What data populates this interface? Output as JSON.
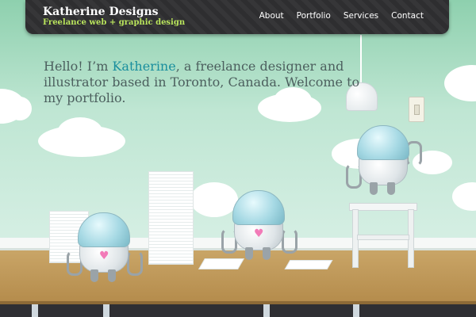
{
  "header": {
    "brand_title": "Katherine Designs",
    "brand_tagline": "Freelance web + graphic design",
    "nav": [
      {
        "label": "About"
      },
      {
        "label": "Portfolio"
      },
      {
        "label": "Services"
      },
      {
        "label": "Contact"
      }
    ]
  },
  "hero": {
    "intro_before": "Hello! I’m ",
    "name": "Katherine",
    "intro_after": ", a freelance designer and illustrator based in Toronto, Canada. Welcome to my portfolio."
  },
  "colors": {
    "accent": "#1a8f9e",
    "tagline": "#b9e45c",
    "nav_bg": "#2e2e30",
    "heart": "#f27bb8"
  },
  "icons": [
    "heart-icon",
    "light-switch-icon",
    "pendant-lamp-icon"
  ]
}
